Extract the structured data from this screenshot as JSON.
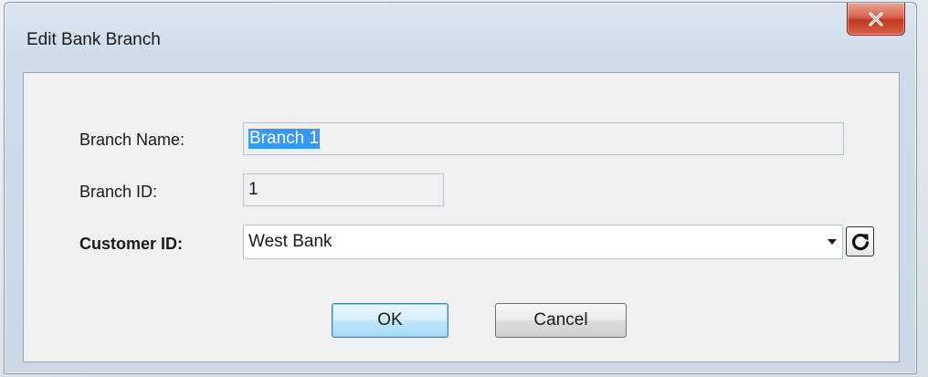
{
  "window": {
    "title": "Edit Bank Branch",
    "close_icon": "close-icon"
  },
  "form": {
    "branch_name_label": "Branch Name:",
    "branch_name_value": "Branch 1",
    "branch_id_label": "Branch ID:",
    "branch_id_value": "1",
    "customer_id_label": "Customer ID:",
    "customer_id_value": "West Bank",
    "refresh_icon": "refresh-icon",
    "dropdown_icon": "dropdown-arrow-icon"
  },
  "buttons": {
    "ok_label": "OK",
    "cancel_label": "Cancel"
  },
  "colors": {
    "selection": "#3399ff",
    "close_button": "#c1381f",
    "default_button_border": "#3c7fb1"
  }
}
